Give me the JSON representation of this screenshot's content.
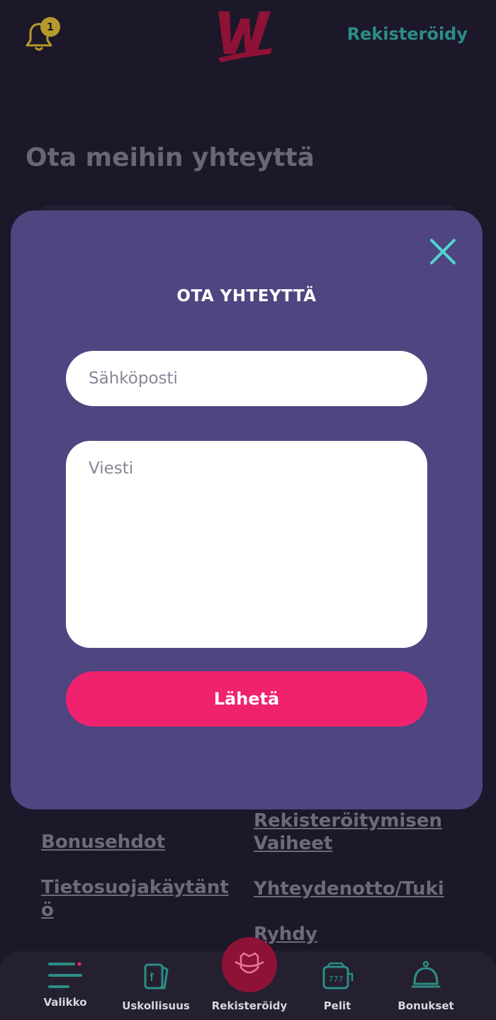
{
  "header": {
    "notification_count": "1",
    "register_label": "Rekisteröidy"
  },
  "page": {
    "title": "Ota meihin yhteyttä"
  },
  "footer_links": [
    "Bonusehdot",
    "Tietosuojakäytänt ö",
    "Rekisteröitymisen Vaiheet",
    "Yhteydenotto/Tuki",
    "Ryhdy"
  ],
  "modal": {
    "title": "OTA YHTEYTTÄ",
    "email_placeholder": "Sähköposti",
    "message_placeholder": "Viesti",
    "send_label": "Lähetä"
  },
  "bottom_nav": {
    "menu": "Valikko",
    "loyalty": "Uskollisuus",
    "register": "Rekisteröidy",
    "games": "Pelit",
    "bonuses": "Bonukset"
  },
  "colors": {
    "background": "#1c1729",
    "modal": "#4f4581",
    "accent": "#f0226e",
    "teal": "#2c8d86",
    "close_icon": "#4fd6d0"
  }
}
